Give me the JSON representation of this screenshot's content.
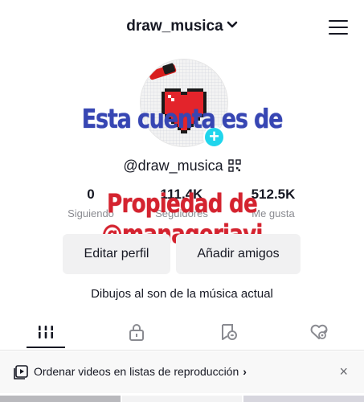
{
  "header": {
    "username": "draw_musica"
  },
  "overlay": {
    "line1": "Esta cuenta es de",
    "line2": "Propiedad de @managerjavi"
  },
  "profile": {
    "handle": "@draw_musica",
    "bio": "Dibujos al son de la música actual"
  },
  "stats": [
    {
      "value": "0",
      "label": "Siguiendo"
    },
    {
      "value": "111.4K",
      "label": "Seguidores"
    },
    {
      "value": "512.5K",
      "label": "Me gusta"
    }
  ],
  "buttons": {
    "edit_profile": "Editar perfil",
    "add_friends": "Añadir amigos"
  },
  "tabs": [
    {
      "icon": "grid-videos-icon",
      "active": true
    },
    {
      "icon": "lock-icon",
      "active": false
    },
    {
      "icon": "repost-icon",
      "active": false
    },
    {
      "icon": "liked-heart-icon",
      "active": false
    }
  ],
  "playlist_bar": {
    "text": "Ordenar videos en listas de reproducción",
    "chevron": "›",
    "close": "×"
  },
  "colors": {
    "overlay_blue": "#3746b3",
    "overlay_red": "#d4232f",
    "accent_cyan": "#20d5ec",
    "button_bg": "#f1f1f2",
    "muted_text": "#8a8b91"
  }
}
